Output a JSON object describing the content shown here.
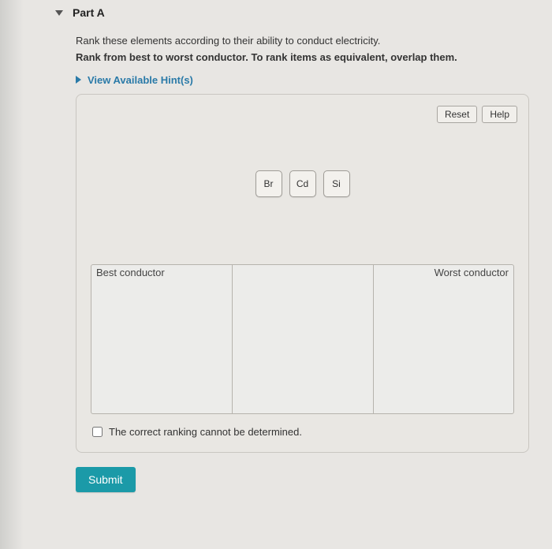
{
  "part": {
    "title": "Part A"
  },
  "instructions": {
    "line1": "Rank these elements according to their ability to conduct electricity.",
    "line2": "Rank from best to worst conductor. To rank items as equivalent, overlap them."
  },
  "hints": {
    "label": "View Available Hint(s)"
  },
  "panel": {
    "reset_label": "Reset",
    "help_label": "Help",
    "tiles": [
      "Br",
      "Cd",
      "Si"
    ],
    "rank_left_label": "Best conductor",
    "rank_right_label": "Worst conductor",
    "cannot_determine_label": "The correct ranking cannot be determined."
  },
  "submit_label": "Submit"
}
